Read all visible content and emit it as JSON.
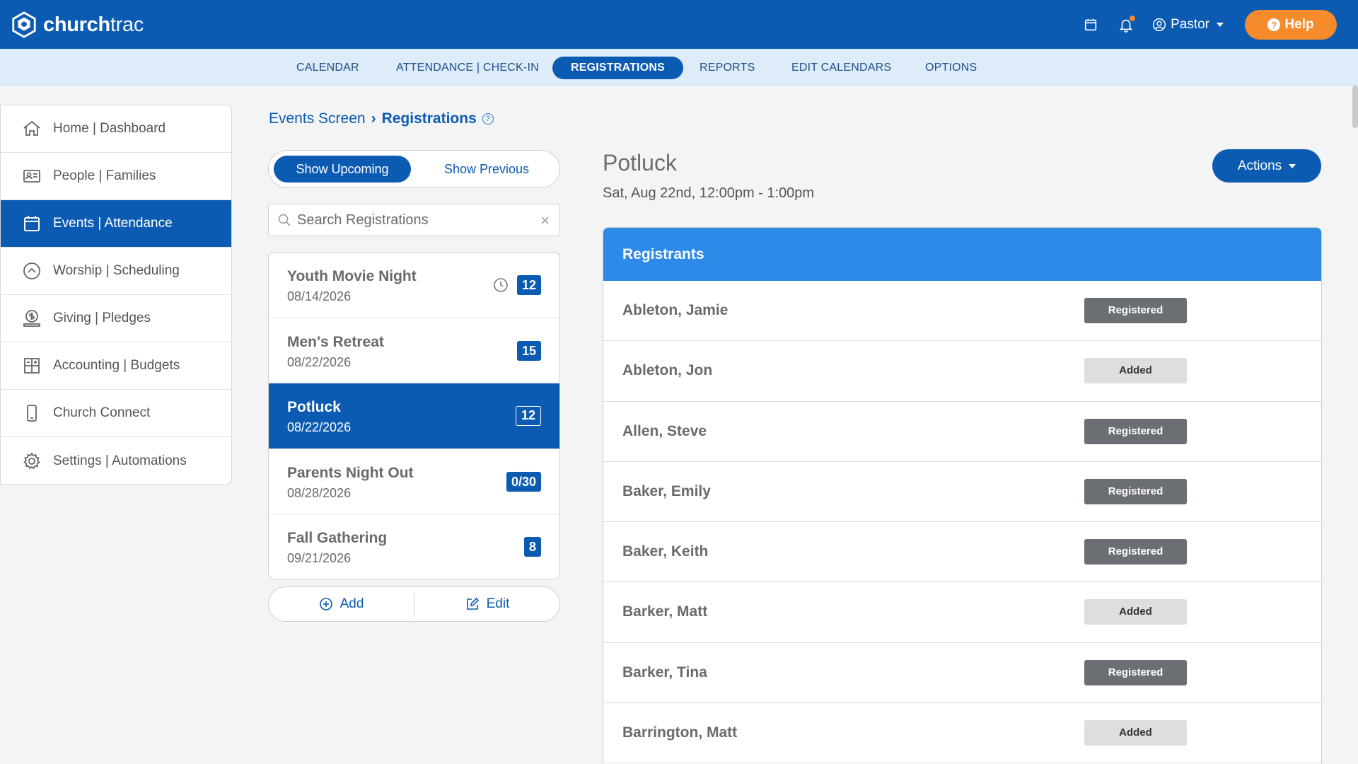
{
  "app": {
    "logo_text_bold": "church",
    "logo_text_light": "trac",
    "user": "Pastor",
    "help": "Help"
  },
  "subnav": {
    "items": [
      {
        "label": "CALENDAR"
      },
      {
        "label": "ATTENDANCE | CHECK-IN"
      },
      {
        "label": "REGISTRATIONS"
      },
      {
        "label": "REPORTS"
      },
      {
        "label": "EDIT CALENDARS"
      },
      {
        "label": "OPTIONS"
      }
    ],
    "active": "REGISTRATIONS"
  },
  "sidebar": {
    "items": [
      {
        "label": "Home | Dashboard",
        "icon": "home-icon"
      },
      {
        "label": "People | Families",
        "icon": "id-card-icon"
      },
      {
        "label": "Events | Attendance",
        "icon": "calendar-icon"
      },
      {
        "label": "Worship | Scheduling",
        "icon": "chevron-circle-icon"
      },
      {
        "label": "Giving | Pledges",
        "icon": "donation-icon"
      },
      {
        "label": "Accounting | Budgets",
        "icon": "grid-icon"
      },
      {
        "label": "Church Connect",
        "icon": "mobile-icon"
      },
      {
        "label": "Settings | Automations",
        "icon": "gear-icon"
      }
    ],
    "active": "Events | Attendance"
  },
  "breadcrumb": {
    "parent": "Events Screen",
    "current": "Registrations"
  },
  "toggle": {
    "upcoming": "Show Upcoming",
    "previous": "Show Previous",
    "selected": "Show Upcoming"
  },
  "search": {
    "placeholder": "Search Registrations"
  },
  "events": [
    {
      "name": "Youth Movie Night",
      "date": "08/14/2026",
      "count": "12",
      "has_clock": true
    },
    {
      "name": "Men's Retreat",
      "date": "08/22/2026",
      "count": "15"
    },
    {
      "name": "Potluck",
      "date": "08/22/2026",
      "count": "12"
    },
    {
      "name": "Parents Night Out",
      "date": "08/28/2026",
      "count": "0/30"
    },
    {
      "name": "Fall Gathering",
      "date": "09/21/2026",
      "count": "8"
    }
  ],
  "selected_event": "Potluck",
  "list_actions": {
    "add": "Add",
    "edit": "Edit"
  },
  "detail": {
    "title": "Potluck",
    "time": "Sat, Aug 22nd, 12:00pm - 1:00pm",
    "actions": "Actions",
    "panel_title": "Registrants",
    "registrants": [
      {
        "name": "Ableton, Jamie",
        "status": "Registered"
      },
      {
        "name": "Ableton, Jon",
        "status": "Added"
      },
      {
        "name": "Allen, Steve",
        "status": "Registered"
      },
      {
        "name": "Baker, Emily",
        "status": "Registered"
      },
      {
        "name": "Baker, Keith",
        "status": "Registered"
      },
      {
        "name": "Barker, Matt",
        "status": "Added"
      },
      {
        "name": "Barker, Tina",
        "status": "Registered"
      },
      {
        "name": "Barrington, Matt",
        "status": "Added"
      }
    ]
  },
  "colors": {
    "primary": "#0c5bb3",
    "panel_header": "#2d8ae8",
    "help": "#f68b2b",
    "subnav_bg": "#deebf8"
  }
}
